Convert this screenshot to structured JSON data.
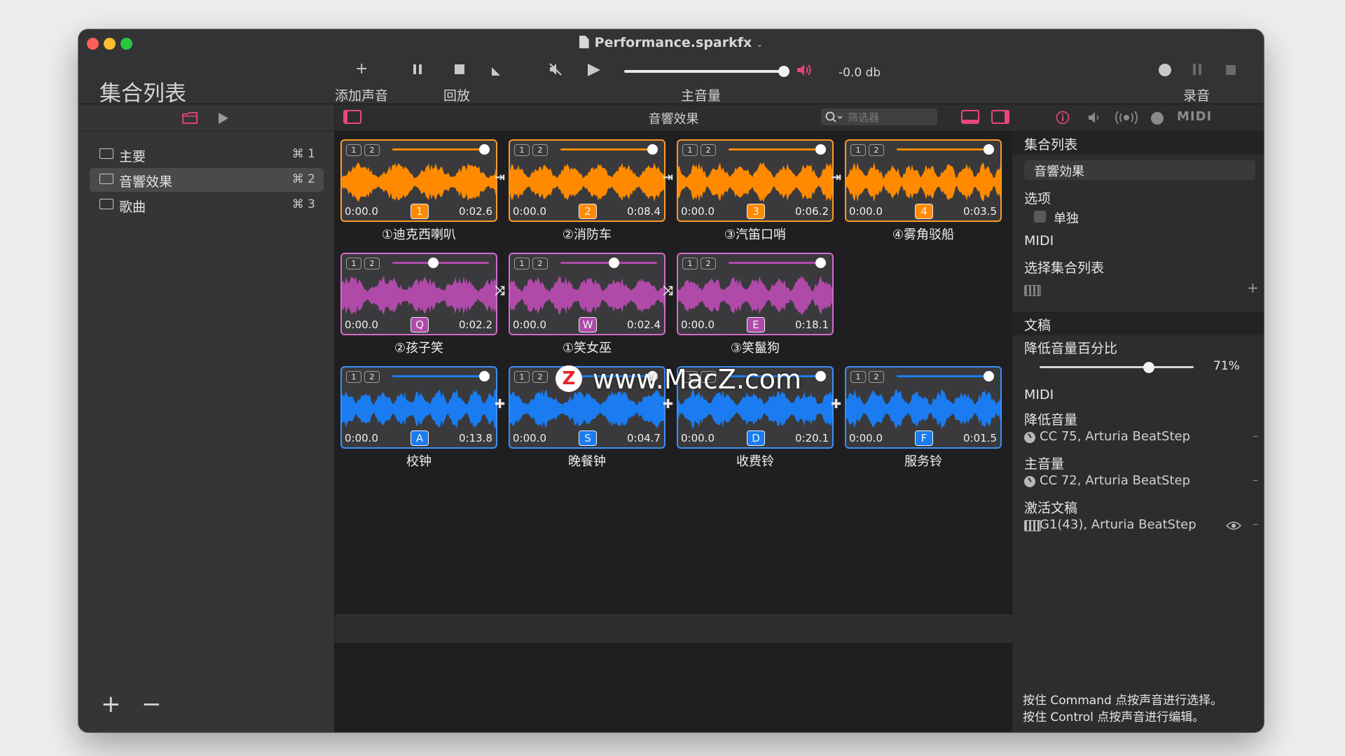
{
  "window": {
    "doc_title": "Performance.sparkfx"
  },
  "sidebar": {
    "heading": "集合列表",
    "items": [
      {
        "label": "主要",
        "shortcut": "⌘ 1",
        "selected": false
      },
      {
        "label": "音響效果",
        "shortcut": "⌘ 2",
        "selected": true
      },
      {
        "label": "歌曲",
        "shortcut": "⌘ 3",
        "selected": false
      }
    ],
    "add_label": "+",
    "remove_label": "−"
  },
  "toolbar": {
    "add_sound_label": "添加声音",
    "playback_label": "回放",
    "master_volume_label": "主音量",
    "master_volume_db": "-0.0 db",
    "master_volume_level": 1.0,
    "record_label": "录音",
    "add_icon": "plus-icon",
    "pause_icon": "pause-icon",
    "stop_icon": "stop-icon",
    "play_icon": "play-icon"
  },
  "main": {
    "title": "音響效果",
    "filter_placeholder": "筛选器",
    "accent": "#e8467c",
    "tiles": [
      {
        "name": "①迪克西喇叭",
        "start": "0:00.0",
        "end": "0:02.6",
        "key": "1",
        "volume": 0.95,
        "color": "#ff8a00",
        "border": "#ff9a2a"
      },
      {
        "name": "②消防车",
        "start": "0:00.0",
        "end": "0:08.4",
        "key": "2",
        "volume": 0.95,
        "color": "#ff8a00",
        "border": "#ff9a2a"
      },
      {
        "name": "③汽笛口哨",
        "start": "0:00.0",
        "end": "0:06.2",
        "key": "3",
        "volume": 0.95,
        "color": "#ff8a00",
        "border": "#ff9a2a"
      },
      {
        "name": "④雾角驳船",
        "start": "0:00.0",
        "end": "0:03.5",
        "key": "4",
        "volume": 0.95,
        "color": "#ff8a00",
        "border": "#ff9a2a"
      },
      {
        "name": "②孩子笑",
        "start": "0:00.0",
        "end": "0:02.2",
        "key": "Q",
        "volume": 0.42,
        "color": "#b04aa8",
        "border": "#d36acb"
      },
      {
        "name": "①笑女巫",
        "start": "0:00.0",
        "end": "0:02.4",
        "key": "W",
        "volume": 0.55,
        "color": "#b04aa8",
        "border": "#d36acb"
      },
      {
        "name": "③笑鬣狗",
        "start": "0:00.0",
        "end": "0:18.1",
        "key": "E",
        "volume": 0.95,
        "color": "#b04aa8",
        "border": "#d36acb"
      },
      {
        "name": "校钟",
        "start": "0:00.0",
        "end": "0:13.8",
        "key": "A",
        "volume": 0.95,
        "color": "#1a7cf0",
        "border": "#3a90f5"
      },
      {
        "name": "晚餐钟",
        "start": "0:00.0",
        "end": "0:04.7",
        "key": "S",
        "volume": 0.95,
        "color": "#1a7cf0",
        "border": "#3a90f5"
      },
      {
        "name": "收费铃",
        "start": "0:00.0",
        "end": "0:20.1",
        "key": "D",
        "volume": 0.95,
        "color": "#1a7cf0",
        "border": "#3a90f5"
      },
      {
        "name": "服务铃",
        "start": "0:00.0",
        "end": "0:01.5",
        "key": "F",
        "volume": 0.95,
        "color": "#1a7cf0",
        "border": "#3a90f5"
      }
    ],
    "channel_1": "1",
    "channel_2": "2"
  },
  "inspector": {
    "setlist_head": "集合列表",
    "setlist_name": "音響効果",
    "options_label": "选项",
    "solo_label": "单独",
    "midi_label_1": "MIDI",
    "select_setlist_label": "选择集合列表",
    "script_head": "文稿",
    "duck_percent_label": "降低音量百分比",
    "duck_percent_value": "71%",
    "duck_percent_level": 0.71,
    "midi_label_2": "MIDI",
    "duck_label": "降低音量",
    "duck_midi": "CC 75, Arturia BeatStep",
    "master_label": "主音量",
    "master_midi": "CC 72, Arturia BeatStep",
    "activate_label": "激活文稿",
    "activate_midi": "G1(43), Arturia BeatStep",
    "midi_tab": "MIDI",
    "hint_1": "按住 Command 点按声音进行选择。",
    "hint_2": "按住 Control 点按声音进行编辑。"
  },
  "watermark": {
    "text": "www.MacZ.com",
    "logo": "Z"
  }
}
